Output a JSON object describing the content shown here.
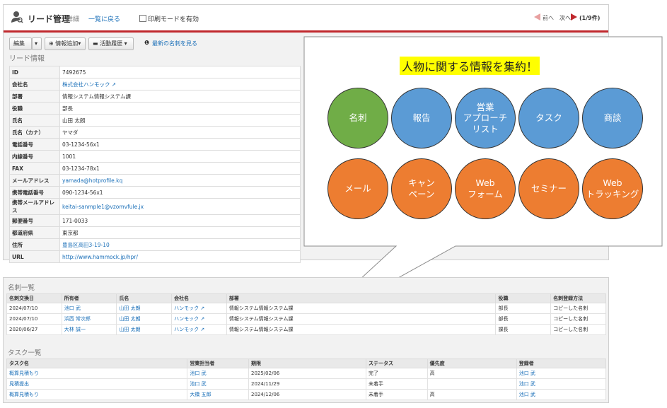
{
  "header": {
    "title": "リード管理",
    "detail_tag": "詳細",
    "back_link": "一覧に戻る",
    "print_mode": "印刷モードを有効",
    "prev": "前へ",
    "next": "次へ",
    "count": "(1/9件)"
  },
  "toolbar": {
    "edit": "編集",
    "add_info": "情報追加",
    "activity": "活動履歴",
    "latest_card": "最新の名刺を見る"
  },
  "lead": {
    "section_title": "リード情報",
    "rows": [
      {
        "key": "ID",
        "value": "7492675"
      },
      {
        "key": "会社名",
        "value": "株式会社ハンモック",
        "link": true
      },
      {
        "key": "部署",
        "value": "情報システム情報システム課"
      },
      {
        "key": "役職",
        "value": "部長"
      },
      {
        "key": "氏名",
        "value": "山田 太朗"
      },
      {
        "key": "氏名（カナ）",
        "value": "ヤマダ"
      },
      {
        "key": "電話番号",
        "value": "03-1234-56x1"
      },
      {
        "key": "内線番号",
        "value": "1001"
      },
      {
        "key": "FAX",
        "value": "03-1234-78x1"
      },
      {
        "key": "メールアドレス",
        "value": "yamada@hotprofile.kq",
        "link": true
      },
      {
        "key": "携帯電話番号",
        "value": "090-1234-56x1"
      },
      {
        "key": "携帯メールアドレス",
        "value": "keitai-sanmple1@vzomvfule.jx",
        "link": true
      },
      {
        "key": "郵便番号",
        "value": "171-0033"
      },
      {
        "key": "都道府県",
        "value": "東京都"
      },
      {
        "key": "住所",
        "value": "豊島区高田3-19-10",
        "link": true
      },
      {
        "key": "URL",
        "value": "http://www.hammock.jp/hpr/",
        "link": true
      }
    ]
  },
  "callout": {
    "title": "人物に関する情報を集約！",
    "circles": [
      {
        "label": "名刺",
        "color": "green"
      },
      {
        "label": "報告",
        "color": "blue"
      },
      {
        "label": "営業\nアプローチ\nリスト",
        "color": "blue"
      },
      {
        "label": "タスク",
        "color": "blue"
      },
      {
        "label": "商談",
        "color": "blue"
      },
      {
        "label": "メール",
        "color": "orange"
      },
      {
        "label": "キャン\nペーン",
        "color": "orange"
      },
      {
        "label": "Web\nフォーム",
        "color": "orange"
      },
      {
        "label": "セミナー",
        "color": "orange"
      },
      {
        "label": "Web\nトラッキング",
        "color": "orange"
      }
    ]
  },
  "cards": {
    "title": "名刺一覧",
    "headers": [
      "名刺交換日",
      "所有者",
      "氏名",
      "会社名",
      "部署",
      "役職",
      "名刺登録方法"
    ],
    "rows": [
      [
        "2024/07/10",
        "池口 武",
        "山田 太朗",
        "ハンモック",
        "情報システム情報システム課",
        "部長",
        "コピーした名刺"
      ],
      [
        "2024/07/10",
        "浜西 常次郎",
        "山田 太朗",
        "ハンモック",
        "情報システム情報システム課",
        "部長",
        "コピーした名刺"
      ],
      [
        "2020/06/27",
        "大林 誠一",
        "山田 太朗",
        "ハンモック",
        "情報システム情報システム課",
        "課長",
        "コピーした名刺"
      ]
    ]
  },
  "tasks": {
    "title": "タスク一覧",
    "headers": [
      "タスク名",
      "営業担当者",
      "期限",
      "ステータス",
      "優先度",
      "登録者"
    ],
    "rows": [
      [
        "概算見積もり",
        "池口 武",
        "2025/02/06",
        "完了",
        "高",
        "池口 武"
      ],
      [
        "見積提出",
        "池口 武",
        "2024/11/29",
        "未着手",
        "",
        "池口 武"
      ],
      [
        "概算見積もり",
        "大橋 五郎",
        "2024/12/06",
        "未着手",
        "高",
        "池口 武"
      ]
    ]
  },
  "colors": {
    "accent": "#c0282d",
    "link": "#1a6fb8",
    "green": "#70ad47",
    "blue": "#5b9bd5",
    "orange": "#ed7d31",
    "highlight": "#ffff00"
  }
}
